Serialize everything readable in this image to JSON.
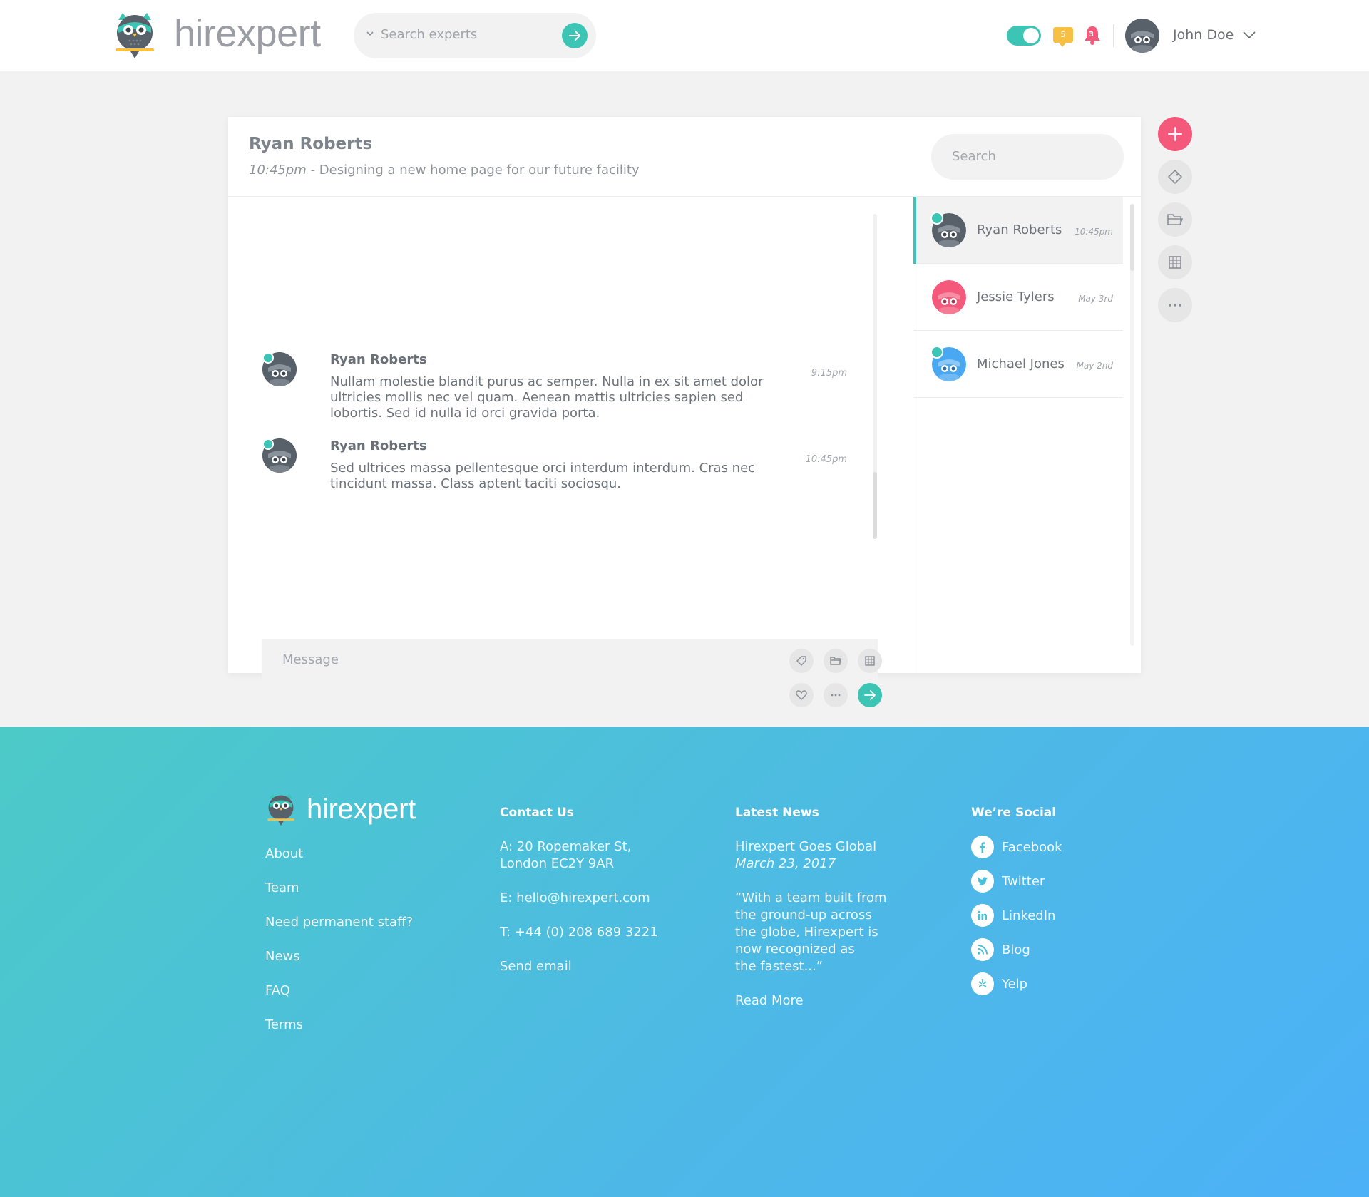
{
  "header": {
    "brand": "hirexpert",
    "search_placeholder": "Search experts",
    "message_count": "5",
    "notification_count": "3",
    "user_name": "John Doe"
  },
  "conversation": {
    "title": "Ryan Roberts",
    "subtitle_time": "10:45pm",
    "subtitle_text": " - Designing a new home page for our future facility",
    "search_placeholder": "Search",
    "messages": [
      {
        "author": "Ryan Roberts",
        "text": "Nullam molestie blandit purus ac semper. Nulla in ex sit amet dolor ultricies mollis nec vel quam. Aenean mattis ultricies sapien sed lobortis. Sed id nulla id orci gravida porta.",
        "time": "9:15pm"
      },
      {
        "author": "Ryan Roberts",
        "text": "Sed ultrices massa pellentesque orci interdum interdum. Cras nec tincidunt massa. Class aptent taciti sociosqu.",
        "time": "10:45pm"
      }
    ],
    "composer_placeholder": "Message"
  },
  "contacts": [
    {
      "name": "Ryan Roberts",
      "time": "10:45pm",
      "online": true,
      "color": "#58606a"
    },
    {
      "name": "Jessie Tylers",
      "time": "May 3rd",
      "online": false,
      "color": "#f4587a"
    },
    {
      "name": "Michael Jones",
      "time": "May 2nd",
      "online": true,
      "color": "#4aa8f0"
    }
  ],
  "footer": {
    "brand": "hirexpert",
    "links": [
      "About",
      "Team",
      "Need permanent staff?",
      "News",
      "FAQ",
      "Terms"
    ],
    "contact": {
      "title": "Contact Us",
      "address_line1": "A: 20 Ropemaker St,",
      "address_line2": "London EC2Y 9AR",
      "email": "E: hello@hirexpert.com",
      "phone": "T: +44 (0) 208 689 3221",
      "send_email": "Send email"
    },
    "news": {
      "title": "Latest News",
      "headline": "Hirexpert Goes Global",
      "date": "March 23, 2017",
      "quote_lines": [
        "“With a team built from",
        "the ground-up across",
        "the globe, Hirexpert is",
        "now recognized as",
        "the fastest...”"
      ],
      "read_more": "Read More"
    },
    "social": {
      "title": "We’re Social",
      "items": [
        {
          "label": "Facebook",
          "icon": "facebook-icon"
        },
        {
          "label": "Twitter",
          "icon": "twitter-icon"
        },
        {
          "label": "LinkedIn",
          "icon": "linkedin-icon"
        },
        {
          "label": "Blog",
          "icon": "rss-icon"
        },
        {
          "label": "Yelp",
          "icon": "yelp-icon"
        }
      ]
    }
  },
  "colors": {
    "accent": "#3cc5b4",
    "danger": "#f4587a",
    "warning": "#f7c042"
  }
}
